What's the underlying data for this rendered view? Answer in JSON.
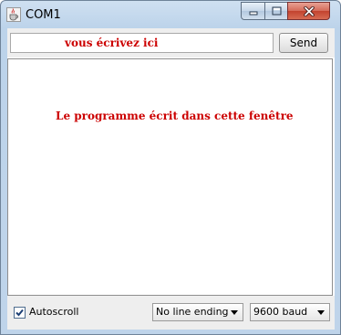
{
  "window": {
    "title": "COM1",
    "icon": "java-cup-icon",
    "controls": [
      "minimize-icon",
      "maximize-icon",
      "close-icon"
    ]
  },
  "input": {
    "value": "vous écrivez ici"
  },
  "send_button": {
    "label": "Send"
  },
  "output": {
    "text": "Le programme écrit dans cette fenêtre"
  },
  "footer": {
    "autoscroll_label": "Autoscroll",
    "autoscroll_checked": true,
    "line_ending": "No line ending",
    "baud_rate": "9600 baud"
  },
  "colors": {
    "annotation_text": "#cc0000",
    "titlebar": "#bcd3ea",
    "close_button": "#c2422e"
  }
}
